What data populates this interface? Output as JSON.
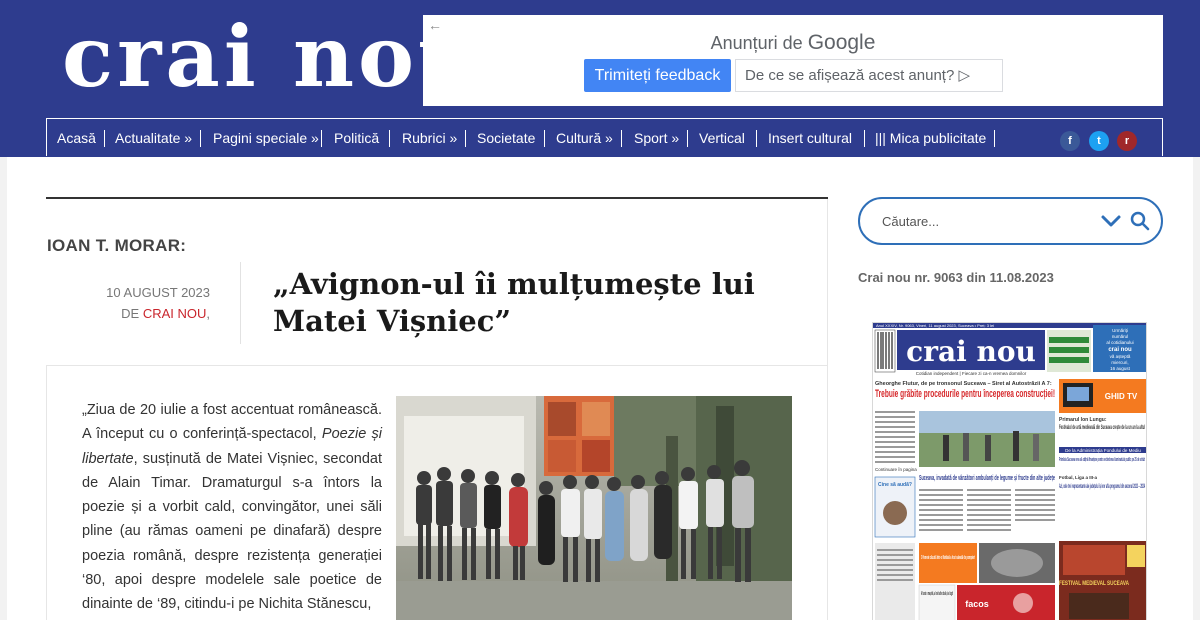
{
  "brand": {
    "logo_text": "crai nou"
  },
  "ad": {
    "title_prefix": "Anunțuri de",
    "title_google": "Google",
    "feedback_label": "Trimiteți feedback",
    "why_label": "De ce se afișează acest anunț? ▷",
    "back_glyph": "←"
  },
  "nav": {
    "items": [
      {
        "label": "Acasă"
      },
      {
        "label": "Actualitate »"
      },
      {
        "label": "Pagini speciale »"
      },
      {
        "label": "Politică"
      },
      {
        "label": "Rubrici »"
      },
      {
        "label": "Societate"
      },
      {
        "label": "Cultură »"
      },
      {
        "label": "Sport »"
      },
      {
        "label": "Vertical"
      },
      {
        "label": "Insert cultural"
      },
      {
        "label": "||| Mica publicitate"
      }
    ]
  },
  "social": {
    "facebook": "f",
    "twitter": "t",
    "rss": "r"
  },
  "article": {
    "author": "IOAN T. MORAR:",
    "date": "10 AUGUST 2023",
    "byline_prefix": "DE",
    "byline_source": "CRAI NOU",
    "byline_suffix": ",",
    "title": "„Avignon-ul îi mulțumește lui Matei Vișniec”",
    "body": [
      {
        "text": "„Ziua de 20 iulie a fost accentuat românească. A început cu o conferință-spectacol, "
      },
      {
        "italic": "Poezie și libertate"
      },
      {
        "text": ", susținută de Matei Vișniec, secondat de Alain Timar. Dramaturgul s-a întors la poezie și a vorbit cald, convingător, unei săli pline (au rămas oameni pe dinafară) despre poezia română, despre rezistența generației ‘80, apoi despre modelele sale poetice de dinainte de ‘89, citindu-i pe Nichita Stănescu,"
      }
    ]
  },
  "sidebar": {
    "search_placeholder": "Căutare...",
    "issue": "Crai nou nr. 9063 din 11.08.2023"
  },
  "frontpage": {
    "masthead": "crai nou",
    "dateline": "Anul XXXIV, Nr. 9063, Vineri, 11 august 2023, Suceava • Preț: 3 lei",
    "tagline": "Cotidian independent | Fiecare zi ca-n vremea domnilor",
    "promo_lines": [
      "Urmăriți",
      "numărul",
      "al cotidianului",
      "crai nou",
      "vă așteptă",
      "miercuri,",
      "16 august"
    ],
    "lead_kicker": "Gheorghe Flutur, de pe tronsonul Suceava – Siret al Autostrăzii A 7:",
    "lead_title": "Trebuie grăbite procedurile pentru începerea construcției!",
    "ghid_tv": "GHID TV",
    "festival_kicker": "Primarul Ion Lungu:",
    "festival_title": "Festivalul de artă medievală din Suceava crește de la un an la altul",
    "admin_note": "De la Administrația Fondului de Mediu",
    "lighting_title": "Primăria Suceava vrea să obțină finanțare pentru extinderea iluminatului public pe 25 de străzi",
    "street_title": "Suceava, invadată de vânzători ambulanți de legume și fructe din alte județe",
    "cine_label": "Cine să audă?",
    "football_kicker": "Fotbal, Liga a III-a",
    "football_title": "Azi, cele trei reprezentante ale județului își vor afla programul din sezonul 2023 – 2024",
    "rescue_title": "O femeie căzută într-o fântână a fost salvată de pompieri",
    "car_title": "A furat o mașină, a lovit alte două și a fugit",
    "facos": "facos",
    "festival_poster": "FESTIVAL MEDIEVAL SUCEAVA",
    "continue_label": "Continuare în pagina"
  },
  "colors": {
    "brand_blue": "#2e3c8e",
    "search_blue": "#2e6fb8",
    "source_red": "#c9252c",
    "headline_red": "#d6282b",
    "ghid_orange": "#f47a20"
  }
}
